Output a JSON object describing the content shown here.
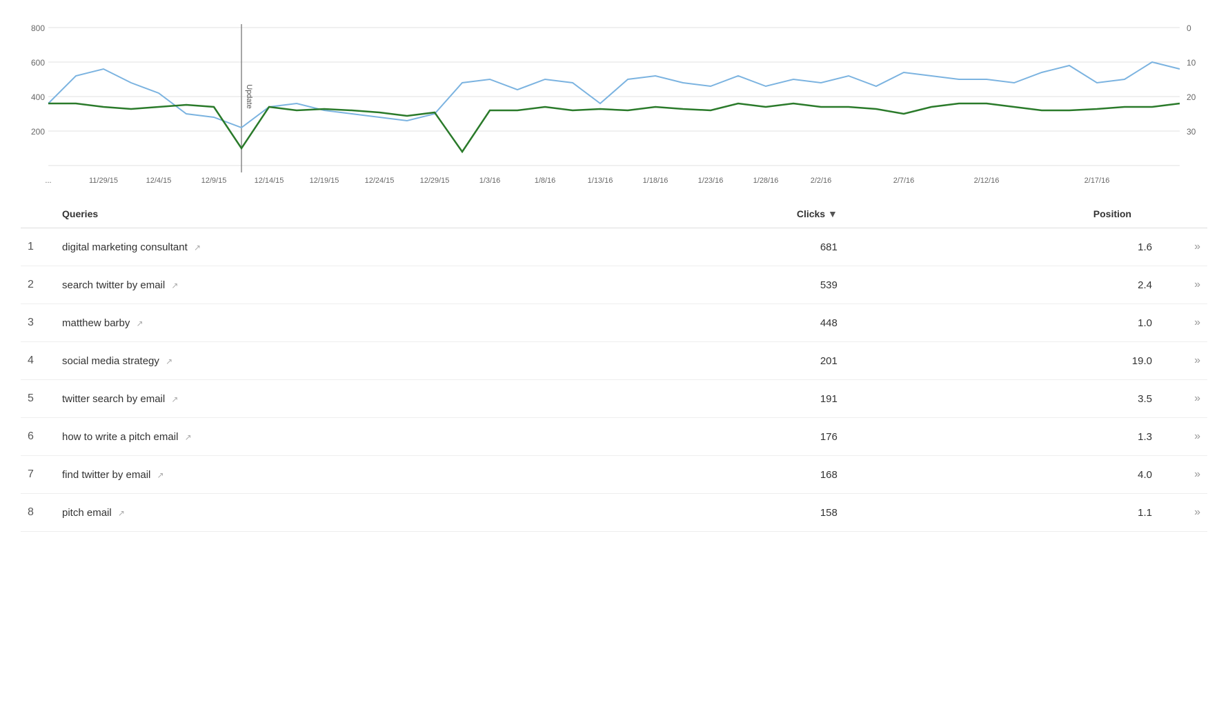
{
  "chart": {
    "y_axis_left": [
      "800",
      "600",
      "400",
      "200"
    ],
    "y_axis_right": [
      "0",
      "10",
      "20",
      "30"
    ],
    "x_labels": [
      "...",
      "11/29/15",
      "12/4/15",
      "12/9/15",
      "12/14/15",
      "12/19/15",
      "12/24/15",
      "12/29/15",
      "1/3/16",
      "1/8/16",
      "1/13/16",
      "1/18/16",
      "1/23/16",
      "1/28/16",
      "2/2/16",
      "2/7/16",
      "2/12/16",
      "2/17/16"
    ],
    "update_label": "Update"
  },
  "table": {
    "headers": {
      "queries": "Queries",
      "clicks": "Clicks",
      "position": "Position"
    },
    "rows": [
      {
        "rank": "1",
        "query": "digital marketing consultant",
        "clicks": "681",
        "position": "1.6"
      },
      {
        "rank": "2",
        "query": "search twitter by email",
        "clicks": "539",
        "position": "2.4"
      },
      {
        "rank": "3",
        "query": "matthew barby",
        "clicks": "448",
        "position": "1.0"
      },
      {
        "rank": "4",
        "query": "social media strategy",
        "clicks": "201",
        "position": "19.0"
      },
      {
        "rank": "5",
        "query": "twitter search by email",
        "clicks": "191",
        "position": "3.5"
      },
      {
        "rank": "6",
        "query": "how to write a pitch email",
        "clicks": "176",
        "position": "1.3"
      },
      {
        "rank": "7",
        "query": "find twitter by email",
        "clicks": "168",
        "position": "4.0"
      },
      {
        "rank": "8",
        "query": "pitch email",
        "clicks": "158",
        "position": "1.1"
      }
    ],
    "arrow": "»"
  }
}
